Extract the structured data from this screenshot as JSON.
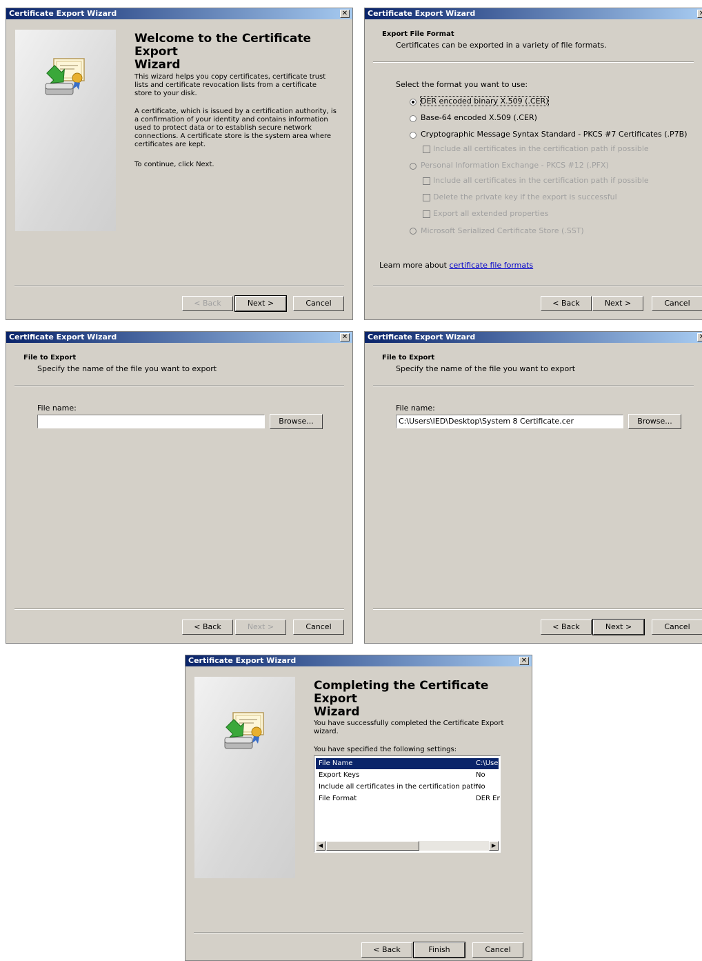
{
  "window_title": "Certificate Export Wizard",
  "close_glyph": "✕",
  "buttons": {
    "back": "< Back",
    "next": "Next >",
    "cancel": "Cancel",
    "finish": "Finish",
    "browse": "Browse..."
  },
  "welcome": {
    "title_line1": "Welcome to the Certificate Export",
    "title_line2": "Wizard",
    "para1": [
      "This wizard helps you copy certificates, certificate trust",
      "lists and certificate revocation lists from a certificate",
      "store to your disk."
    ],
    "para2": [
      "A certificate, which is issued by a certification authority, is",
      "a confirmation of your identity and contains information",
      "used to protect data or to establish secure network",
      "connections. A certificate store is the system area where",
      "certificates are kept."
    ],
    "para3": "To continue, click Next."
  },
  "format": {
    "header_title": "Export File Format",
    "header_sub": "Certificates can be exported in a variety of file formats.",
    "prompt": "Select the format you want to use:",
    "options": [
      "DER encoded binary X.509 (.CER)",
      "Base-64 encoded X.509 (.CER)",
      "Cryptographic Message Syntax Standard - PKCS #7 Certificates (.P7B)",
      "Include all certificates in the certification path if possible",
      "Personal Information Exchange - PKCS #12 (.PFX)",
      "Include all certificates in the certification path if possible",
      "Delete the private key if the export is successful",
      "Export all extended properties",
      "Microsoft Serialized Certificate Store (.SST)"
    ],
    "learn_prefix": "Learn more about ",
    "learn_link": "certificate file formats"
  },
  "file": {
    "header_title": "File to Export",
    "header_sub": "Specify the name of the file you want to export",
    "label": "File name:",
    "empty_value": "",
    "filled_value": "C:\\Users\\IED\\Desktop\\System 8 Certificate.cer"
  },
  "complete": {
    "title_line1": "Completing the Certificate Export",
    "title_line2": "Wizard",
    "para1": [
      "You have successfully completed the Certificate Export",
      "wizard."
    ],
    "para2": "You have specified the following settings:",
    "rows": [
      {
        "k": "File Name",
        "v": "C:\\Use"
      },
      {
        "k": "Export Keys",
        "v": "No"
      },
      {
        "k": "Include all certificates in the certification path",
        "v": "No"
      },
      {
        "k": "File Format",
        "v": "DER En"
      }
    ],
    "scroll_left": "◀",
    "scroll_right": "▶"
  }
}
